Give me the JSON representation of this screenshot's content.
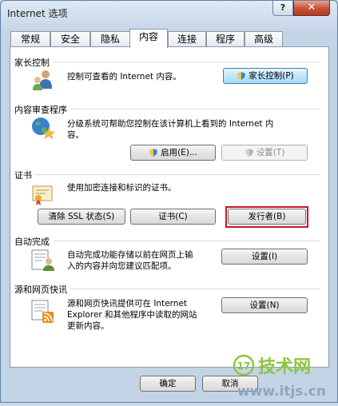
{
  "window": {
    "title": "Internet 选项",
    "help_label": "?",
    "close_label": "✕"
  },
  "tabs": [
    "常规",
    "安全",
    "隐私",
    "内容",
    "连接",
    "程序",
    "高级"
  ],
  "active_tab": "内容",
  "sections": {
    "parental": {
      "label": "家长控制",
      "desc": "控制可查看的 Internet 内容。",
      "button": "家长控制(P)"
    },
    "advisor": {
      "label": "内容审查程序",
      "desc": "分级系统可帮助您控制在该计算机上看到的 Internet 内\n容。",
      "enable_button": "启用(E)...",
      "settings_button": "设置(T)"
    },
    "certificates": {
      "label": "证书",
      "desc": "使用加密连接和标识的证书。",
      "clear_ssl_button": "清除 SSL 状态(S)",
      "certificates_button": "证书(C)",
      "publishers_button": "发行者(B)"
    },
    "autocomplete": {
      "label": "自动完成",
      "desc": "自动完成功能存储以前在网页上输\n入的内容并向您建议匹配项。",
      "button": "设置(I)"
    },
    "feeds": {
      "label": "源和网页快讯",
      "desc": "源和网页快讯提供可在 Internet\nExplorer 和其他程序中读取的网站\n更新内容。",
      "button": "设置(N)"
    }
  },
  "footer": {
    "ok_button": "确定",
    "cancel_button": "取消"
  },
  "watermark": {
    "brand_num": "17",
    "brand_text": "技术网",
    "url": "www.itjs.cn"
  },
  "colors": {
    "accent": "#3c7fb1",
    "highlight": "#c8171e",
    "watermark": "#8cc63f"
  }
}
